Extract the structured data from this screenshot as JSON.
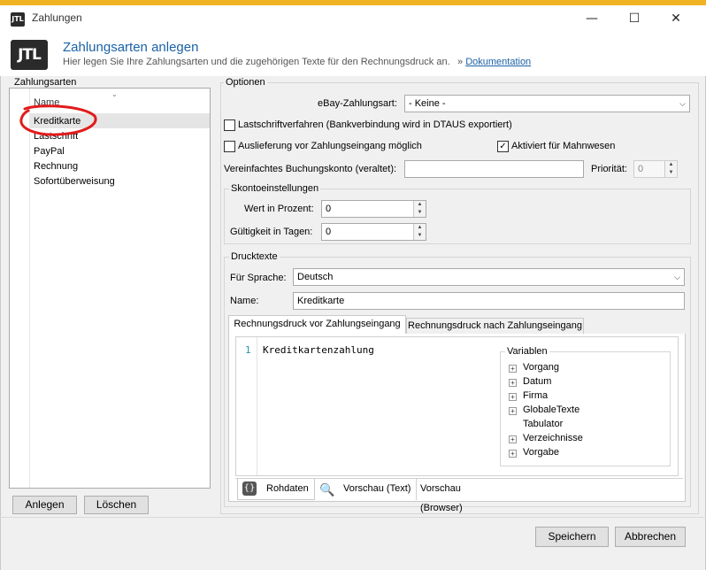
{
  "window": {
    "title": "Zahlungen",
    "min_icon": "minimize-icon",
    "max_icon": "maximize-icon",
    "close_icon": "close-icon"
  },
  "header": {
    "logo_text": "JTL",
    "title": "Zahlungsarten anlegen",
    "subtitle": "Hier legen Sie Ihre Zahlungsarten und die zugehörigen Texte für den Rechnungsdruck an.",
    "link_prefix": "»",
    "link": "Dokumentation"
  },
  "left": {
    "group_label": "Zahlungsarten",
    "column_header": "Name",
    "items": [
      "Kreditkarte",
      "Lastschrift",
      "PayPal",
      "Rechnung",
      "Sofortüberweisung"
    ],
    "selected_index": 0,
    "add_button": "Anlegen",
    "delete_button": "Löschen"
  },
  "options": {
    "group_label": "Optionen",
    "ebay_label": "eBay-Zahlungsart:",
    "ebay_value": "- Keine -",
    "lastschrift_label": "Lastschriftverfahren (Bankverbindung wird in DTAUS exportiert)",
    "lastschrift_checked": false,
    "auslieferung_label": "Auslieferung vor Zahlungseingang möglich",
    "auslieferung_checked": false,
    "mahnwesen_label": "Aktiviert für Mahnwesen",
    "mahnwesen_checked": true,
    "buchungskonto_label": "Vereinfachtes Buchungskonto (veraltet):",
    "buchungskonto_value": "",
    "prioritaet_label": "Priorität:",
    "prioritaet_value": "0"
  },
  "skonto": {
    "group_label": "Skontoeinstellungen",
    "wert_label": "Wert in Prozent:",
    "wert_value": "0",
    "gueltig_label": "Gültigkeit in Tagen:",
    "gueltig_value": "0"
  },
  "drucktexte": {
    "group_label": "Drucktexte",
    "sprache_label": "Für Sprache:",
    "sprache_value": "Deutsch",
    "name_label": "Name:",
    "name_value": "Kreditkarte",
    "tabs": [
      "Rechnungsdruck vor Zahlungseingang",
      "Rechnungsdruck nach Zahlungseingang"
    ],
    "active_tab": 0,
    "line_number": "1",
    "editor_text": "Kreditkartenzahlung",
    "variables_label": "Variablen",
    "variables": [
      {
        "label": "Vorgang",
        "expandable": true
      },
      {
        "label": "Datum",
        "expandable": true
      },
      {
        "label": "Firma",
        "expandable": true
      },
      {
        "label": "GlobaleTexte",
        "expandable": true
      },
      {
        "label": "Tabulator",
        "expandable": false
      },
      {
        "label": "Verzeichnisse",
        "expandable": true
      },
      {
        "label": "Vorgabe",
        "expandable": true
      }
    ],
    "bottom_tabs": [
      "Rohdaten",
      "Vorschau (Text)",
      "Vorschau (Browser)"
    ],
    "bottom_active": 0
  },
  "footer": {
    "save_button": "Speichern",
    "cancel_button": "Abbrechen"
  },
  "colors": {
    "accent": "#1b62a6",
    "annotation": "#e21b1b",
    "selected_row": "#e5e5e5"
  }
}
